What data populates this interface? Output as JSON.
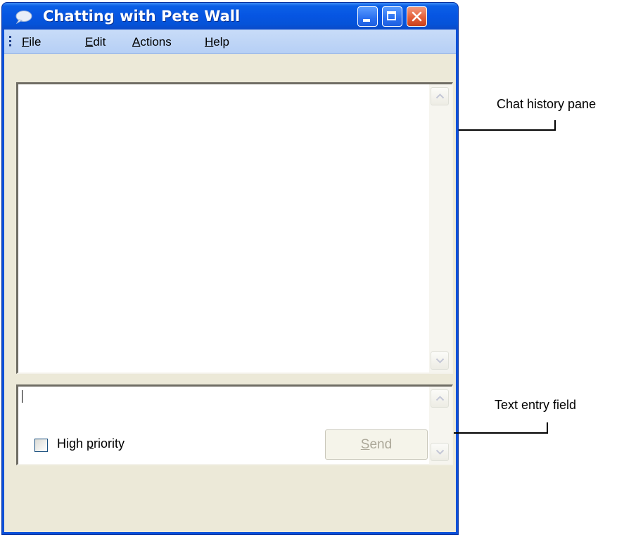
{
  "window": {
    "title": "Chatting with Pete Wall"
  },
  "title_buttons": {
    "minimize_icon": "minimize-icon",
    "maximize_icon": "maximize-icon",
    "close_icon": "close-icon"
  },
  "menu": {
    "items": [
      {
        "accel": "F",
        "rest": "ile"
      },
      {
        "accel": "E",
        "rest": "dit"
      },
      {
        "accel": "A",
        "rest": "ctions"
      },
      {
        "accel": "H",
        "rest": "elp"
      }
    ]
  },
  "bottom": {
    "checkbox_before": "High ",
    "checkbox_accel": "p",
    "checkbox_after": "riority",
    "checkbox_checked": false,
    "send_accel": "S",
    "send_rest": "end",
    "send_enabled": false
  },
  "callouts": {
    "history": "Chat history pane",
    "entry": "Text entry field"
  },
  "colors": {
    "titlebar": "#0655e2",
    "menubar": "#c8dcf8",
    "dialog_bg": "#ece9d8",
    "close_button": "#e4603a"
  }
}
